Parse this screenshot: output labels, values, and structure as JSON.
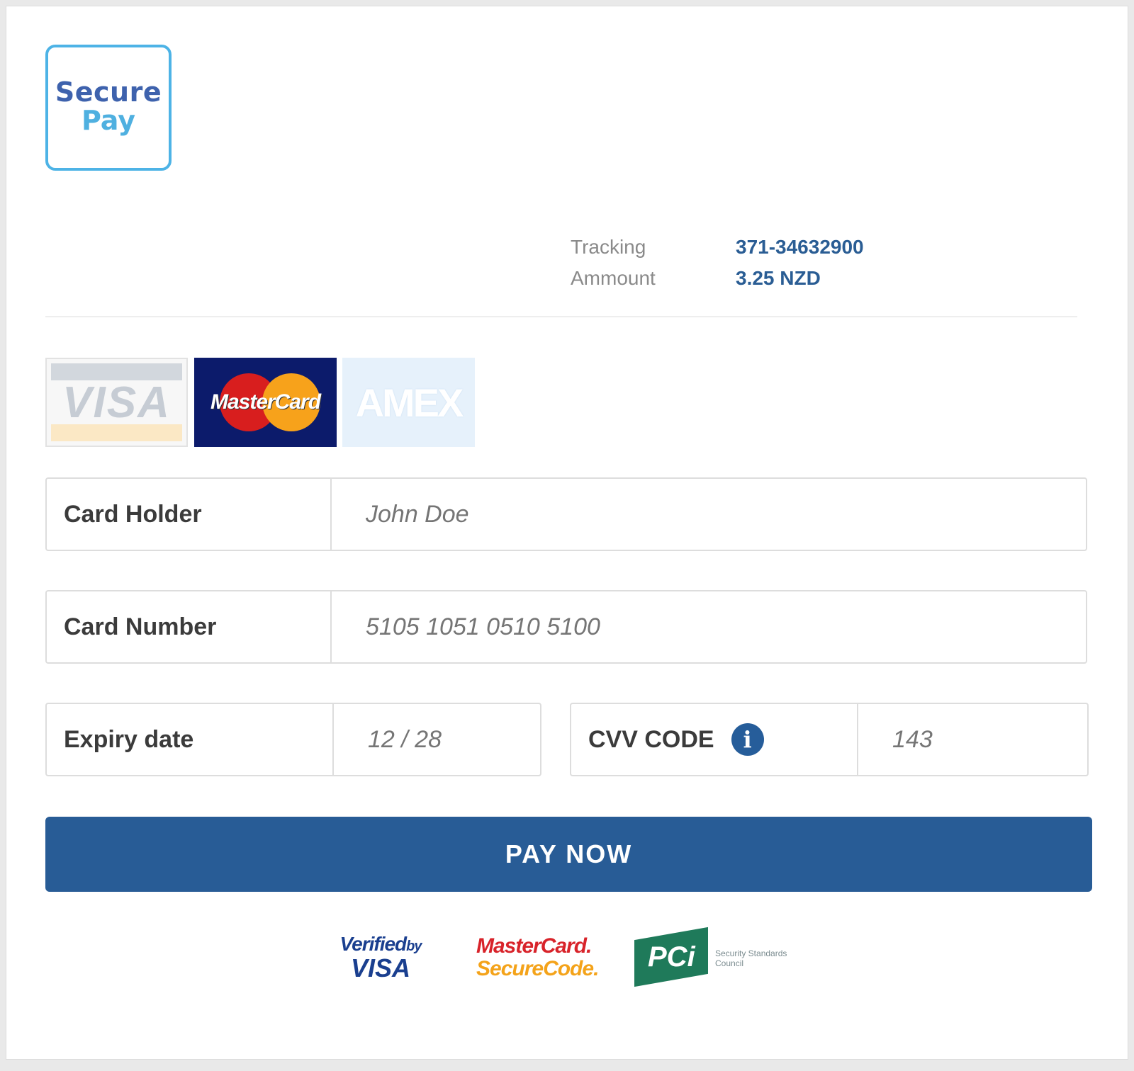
{
  "logo": {
    "line1": "Secure",
    "line2": "Pay"
  },
  "summary": {
    "tracking_label": "Tracking",
    "tracking_value": "371-34632900",
    "amount_label": "Ammount",
    "amount_value": "3.25 NZD"
  },
  "card_logos": {
    "visa": "VISA",
    "mastercard": "MasterCard",
    "amex": "AMEX"
  },
  "form": {
    "card_holder": {
      "label": "Card Holder",
      "placeholder": "John Doe"
    },
    "card_number": {
      "label": "Card Number",
      "placeholder": "5105 1051 0510 5100"
    },
    "expiry": {
      "label": "Expiry date",
      "placeholder": "12 / 28"
    },
    "cvv": {
      "label": "CVV CODE",
      "placeholder": "143",
      "info_icon": "info-icon"
    }
  },
  "pay_button": {
    "label": "PAY NOW"
  },
  "badges": {
    "verified_by_visa": {
      "line1": "Verified",
      "by": "by",
      "line2": "VISA"
    },
    "mastercard_securecode": {
      "line1": "MasterCard.",
      "line2": "SecureCode."
    },
    "pci": {
      "mark": "PCi",
      "note": "Security Standards Council"
    }
  },
  "colors": {
    "primary": "#285c96",
    "accent_value": "#2a5d94",
    "logo_border": "#4db3e6"
  }
}
